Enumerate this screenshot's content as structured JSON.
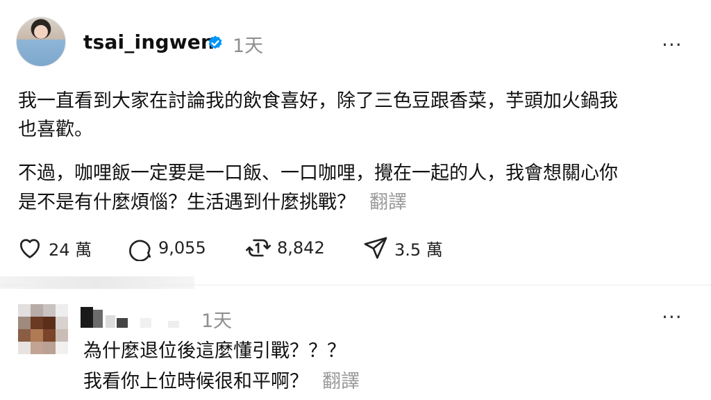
{
  "post": {
    "username": "tsai_ingwen",
    "time": "1天",
    "more": "···",
    "paragraph1_line1": "我一直看到大家在討論我的飲食喜好，除了三色豆跟香菜，芋頭加火鍋我",
    "paragraph1_line2": "也喜歡。",
    "paragraph2_line1": "不過，咖哩飯一定要是一口飯、一口咖哩，攪在一起的人，我會想關心你",
    "paragraph2_line2": "是不是有什麼煩惱？生活遇到什麼挑戰？",
    "translate": "翻譯",
    "likes": "24 萬",
    "comments": "9,055",
    "reposts": "8,842",
    "shares": "3.5 萬"
  },
  "comment": {
    "time": "1天",
    "more": "···",
    "line1": "為什麼退位後這麼懂引戰？？？",
    "line2": "我看你上位時候很和平啊？",
    "translate": "翻譯"
  },
  "colors": {
    "verified": "#0095f6",
    "muted": "#8e8e8e"
  }
}
